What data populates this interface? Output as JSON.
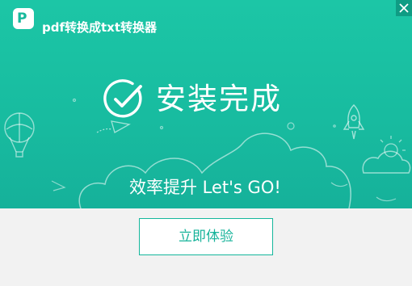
{
  "window": {
    "title": "pdf转换成txt转换器",
    "logo_letter": "P",
    "close_icon": "close-icon"
  },
  "main": {
    "status_text": "安装完成",
    "status_icon": "check-circle-icon",
    "slogan": "效率提升 Let's GO!"
  },
  "footer": {
    "action_label": "立即体验"
  },
  "colors": {
    "brand": "#1cc6a6",
    "button_text": "#16b39a",
    "background": "#f2f2f2"
  }
}
